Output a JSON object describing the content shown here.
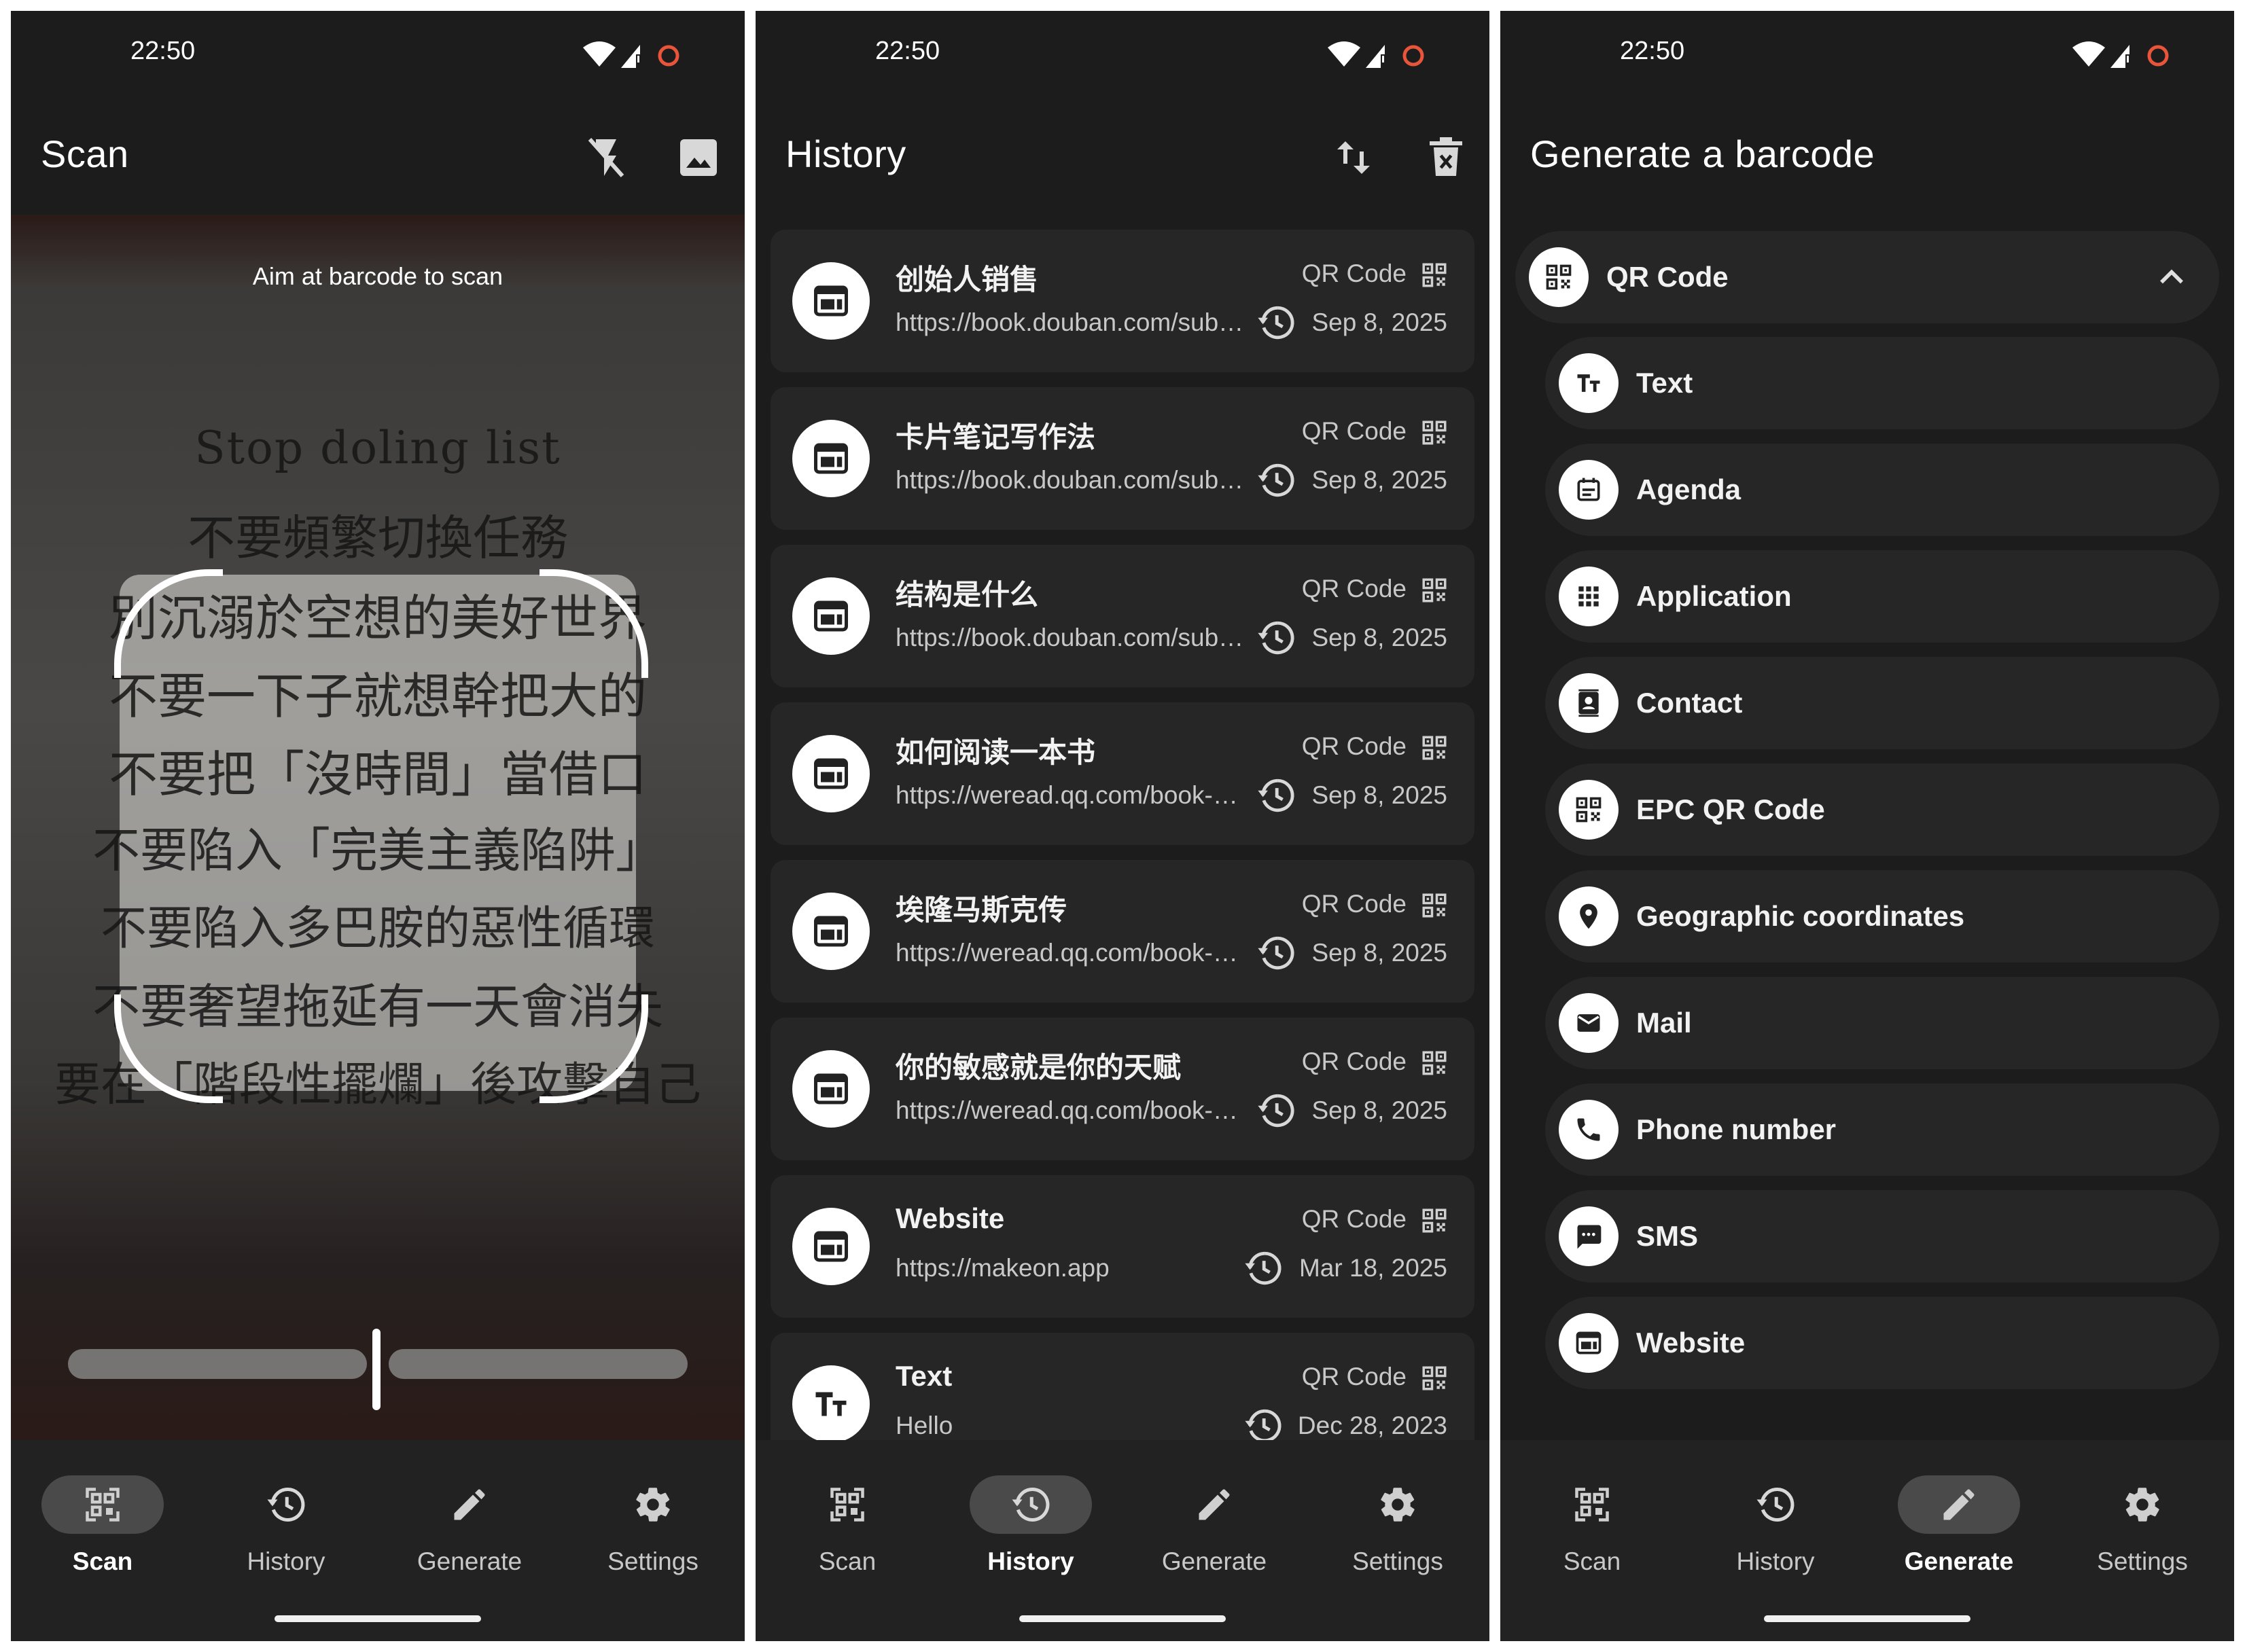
{
  "status": {
    "time": "22:50"
  },
  "scan": {
    "title": "Scan",
    "aim_hint": "Aim at barcode to scan",
    "book_lines": [
      "Stop doling list",
      "不要頻繁切換任務",
      "別沉溺於空想的美好世界",
      "不要一下子就想幹把大的",
      "不要把「沒時間」當借口",
      "不要陷入「完美主義陷阱」",
      "不要陷入多巴胺的惡性循環",
      "不要奢望拖延有一天會消失",
      "要在「階段性擺爛」後攻擊自己"
    ],
    "zoom_level": 0.5
  },
  "history": {
    "title": "History",
    "items": [
      {
        "title": "创始人销售",
        "url": "https://book.douban.com/subject/",
        "type": "QR Code",
        "date": "Sep 8, 2025",
        "icon": "website-icon"
      },
      {
        "title": "卡片笔记写作法",
        "url": "https://book.douban.com/subject/",
        "type": "QR Code",
        "date": "Sep 8, 2025",
        "icon": "website-icon"
      },
      {
        "title": "结构是什么",
        "url": "https://book.douban.com/subject/",
        "type": "QR Code",
        "date": "Sep 8, 2025",
        "icon": "website-icon"
      },
      {
        "title": "如何阅读一本书",
        "url": "https://weread.qq.com/book-detail",
        "type": "QR Code",
        "date": "Sep 8, 2025",
        "icon": "website-icon"
      },
      {
        "title": "埃隆马斯克传",
        "url": "https://weread.qq.com/book-detail",
        "type": "QR Code",
        "date": "Sep 8, 2025",
        "icon": "website-icon"
      },
      {
        "title": "你的敏感就是你的天赋",
        "url": "https://weread.qq.com/book-detail",
        "type": "QR Code",
        "date": "Sep 8, 2025",
        "icon": "website-icon"
      },
      {
        "title": "Website",
        "url": "https://makeon.app",
        "type": "QR Code",
        "date": "Mar 18, 2025",
        "icon": "website-icon"
      },
      {
        "title": "Text",
        "url": "Hello",
        "type": "QR Code",
        "date": "Dec 28, 2023",
        "icon": "text-icon"
      }
    ]
  },
  "generate": {
    "title": "Generate a barcode",
    "format": "QR Code",
    "types": [
      {
        "label": "Text",
        "icon": "text-icon"
      },
      {
        "label": "Agenda",
        "icon": "calendar-icon"
      },
      {
        "label": "Application",
        "icon": "apps-grid-icon"
      },
      {
        "label": "Contact",
        "icon": "contact-icon"
      },
      {
        "label": "EPC QR Code",
        "icon": "qr-code-icon"
      },
      {
        "label": "Geographic coordinates",
        "icon": "location-pin-icon"
      },
      {
        "label": "Mail",
        "icon": "mail-icon"
      },
      {
        "label": "Phone number",
        "icon": "phone-icon"
      },
      {
        "label": "SMS",
        "icon": "sms-icon"
      },
      {
        "label": "Website",
        "icon": "website-icon"
      }
    ]
  },
  "nav": {
    "scan": "Scan",
    "history": "History",
    "generate": "Generate",
    "settings": "Settings"
  },
  "colors": {
    "background": "#1c1c1c",
    "card": "#262626",
    "nav_active": "#4a4a4a",
    "status_ring": "#e8553a"
  }
}
